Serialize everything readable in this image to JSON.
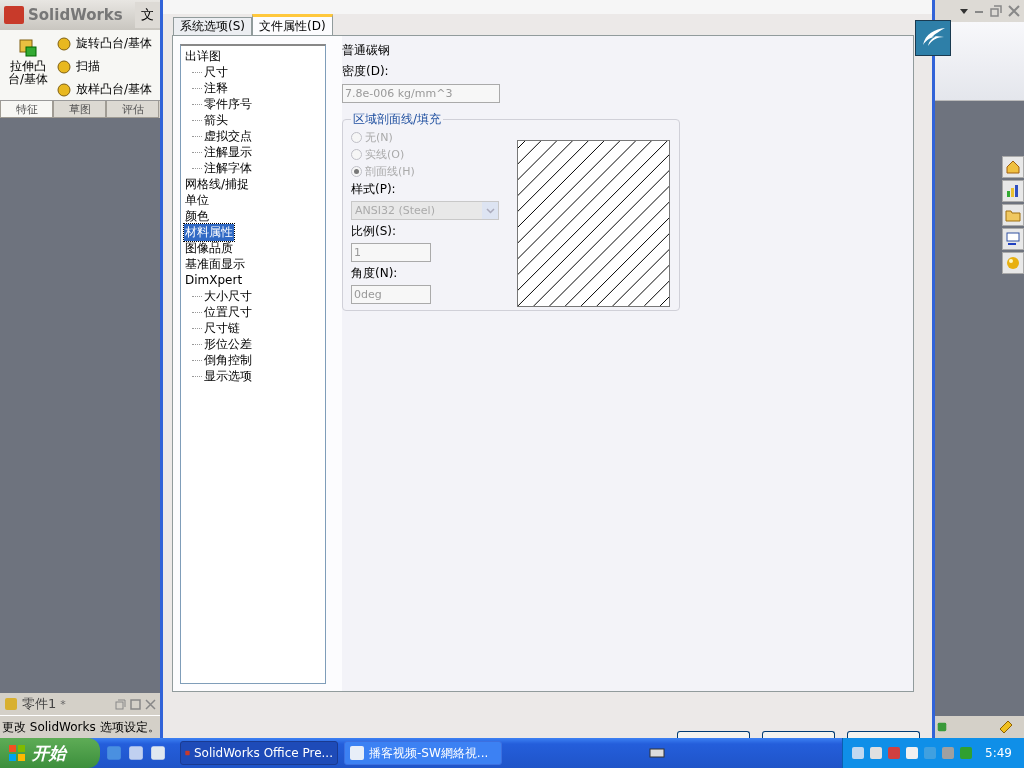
{
  "app": {
    "title": "SolidWorks",
    "menu_fragment": "文"
  },
  "toolbar": {
    "large_button": "拉伸凸台/基体",
    "items": [
      "旋转凸台/基体",
      "扫描",
      "放样凸台/基体"
    ]
  },
  "command_tabs": [
    {
      "label": "特征",
      "selected": true
    },
    {
      "label": "草图",
      "selected": false
    },
    {
      "label": "评估",
      "selected": false
    }
  ],
  "document_tab": {
    "title": "零件1",
    "modified_mark": "*"
  },
  "status_bar": "更改 SolidWorks 选项设定。",
  "dialog": {
    "tabs": [
      {
        "label": "系统选项(S)",
        "selected": false
      },
      {
        "label": "文件属性(D)",
        "selected": true
      }
    ],
    "tree": [
      {
        "label": "出详图",
        "selected": false,
        "children": [
          {
            "label": "尺寸",
            "selected": false
          },
          {
            "label": "注释",
            "selected": false
          },
          {
            "label": "零件序号",
            "selected": false
          },
          {
            "label": "箭头",
            "selected": false
          },
          {
            "label": "虚拟交点",
            "selected": false
          },
          {
            "label": "注解显示",
            "selected": false
          },
          {
            "label": "注解字体",
            "selected": false
          }
        ]
      },
      {
        "label": "网格线/捕捉",
        "selected": false
      },
      {
        "label": "单位",
        "selected": false
      },
      {
        "label": "颜色",
        "selected": false
      },
      {
        "label": "材料属性",
        "selected": true
      },
      {
        "label": "图像品质",
        "selected": false
      },
      {
        "label": "基准面显示",
        "selected": false
      },
      {
        "label": "DimXpert",
        "selected": false,
        "children": [
          {
            "label": "大小尺寸",
            "selected": false
          },
          {
            "label": "位置尺寸",
            "selected": false
          },
          {
            "label": "尺寸链",
            "selected": false
          },
          {
            "label": "形位公差",
            "selected": false
          },
          {
            "label": "倒角控制",
            "selected": false
          },
          {
            "label": "显示选项",
            "selected": false
          }
        ]
      }
    ],
    "material": "普通碳钢",
    "density_label": "密度(D):",
    "density_value": "7.8e-006 kg/mm^3",
    "hatch_group": {
      "title": "区域剖面线/填充",
      "disabled": true,
      "options": [
        {
          "label": "无(N)",
          "selected": false
        },
        {
          "label": "实线(O)",
          "selected": false
        },
        {
          "label": "剖面线(H)",
          "selected": true
        }
      ],
      "style_label": "样式(P):",
      "style_value": "ANSI32 (Steel)",
      "scale_label": "比例(S):",
      "scale_value": "1",
      "angle_label": "角度(N):",
      "angle_value": "0deg"
    }
  },
  "taskbar": {
    "start": "开始",
    "tasks": [
      {
        "label": "SolidWorks Office Pre...",
        "selected": true
      },
      {
        "label": "播客视频-SW網絡視...",
        "selected": false
      }
    ],
    "clock": "5:49"
  }
}
